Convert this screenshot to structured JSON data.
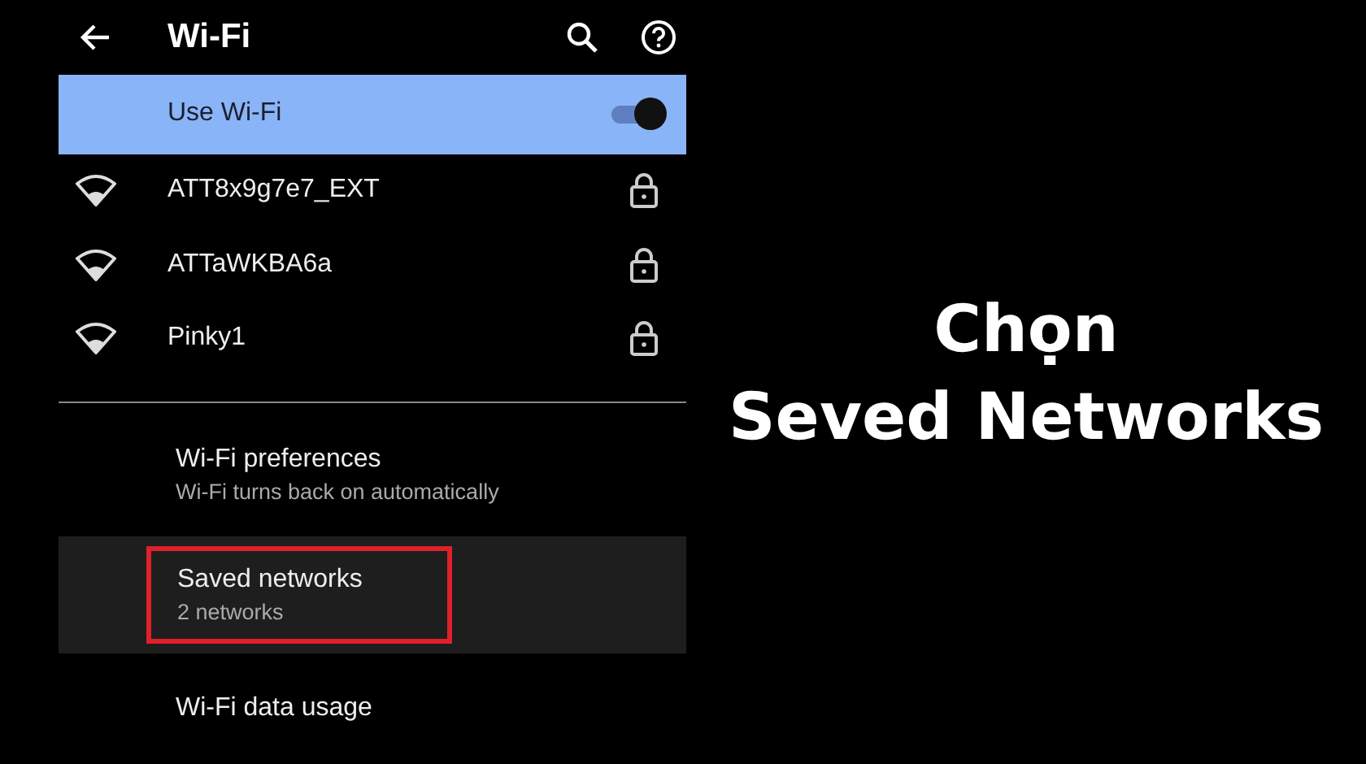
{
  "header": {
    "title": "Wi-Fi"
  },
  "use_wifi": {
    "label": "Use Wi-Fi",
    "on": true
  },
  "networks": [
    {
      "name": "ATT8x9g7e7_EXT",
      "locked": true
    },
    {
      "name": "ATTaWKBA6a",
      "locked": true
    },
    {
      "name": "Pinky1",
      "locked": true
    }
  ],
  "menu_items": [
    {
      "title": "Wi-Fi preferences",
      "subtitle": "Wi-Fi turns back on automatically",
      "selected": false,
      "outlined": false
    },
    {
      "title": "Saved networks",
      "subtitle": "2 networks",
      "selected": true,
      "outlined": true
    },
    {
      "title": "Wi-Fi data usage",
      "selected": false,
      "outlined": false
    }
  ],
  "caption": {
    "lines": [
      "Chọn",
      "Seved Networks"
    ]
  }
}
